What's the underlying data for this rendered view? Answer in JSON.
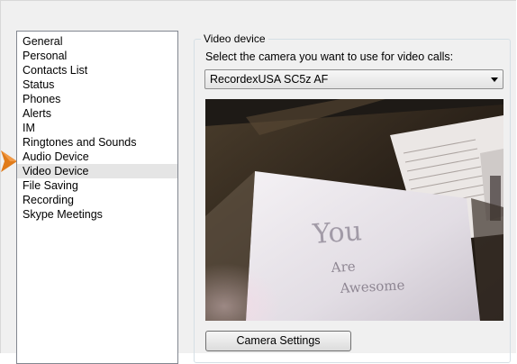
{
  "sidebar": {
    "items": [
      {
        "label": "General"
      },
      {
        "label": "Personal"
      },
      {
        "label": "Contacts List"
      },
      {
        "label": "Status"
      },
      {
        "label": "Phones"
      },
      {
        "label": "Alerts"
      },
      {
        "label": "IM"
      },
      {
        "label": "Ringtones and Sounds"
      },
      {
        "label": "Audio Device"
      },
      {
        "label": "Video Device",
        "selected": true
      },
      {
        "label": "File Saving"
      },
      {
        "label": "Recording"
      },
      {
        "label": "Skype Meetings"
      }
    ]
  },
  "video_device": {
    "group_title": "Video device",
    "instruction": "Select the camera you want to use for video calls:",
    "selected_camera": "RecordexUSA SC5z AF",
    "camera_settings_label": "Camera Settings",
    "preview_handwriting": [
      "You",
      "Are",
      "Awesome"
    ]
  },
  "colors": {
    "pointer_arrow": "#e07b1a",
    "selected_item_bg": "#e5e5e5",
    "window_bg": "#f0f0f0"
  },
  "icons": {
    "pointer": "arrow-right-icon",
    "dropdown": "chevron-down-icon"
  }
}
